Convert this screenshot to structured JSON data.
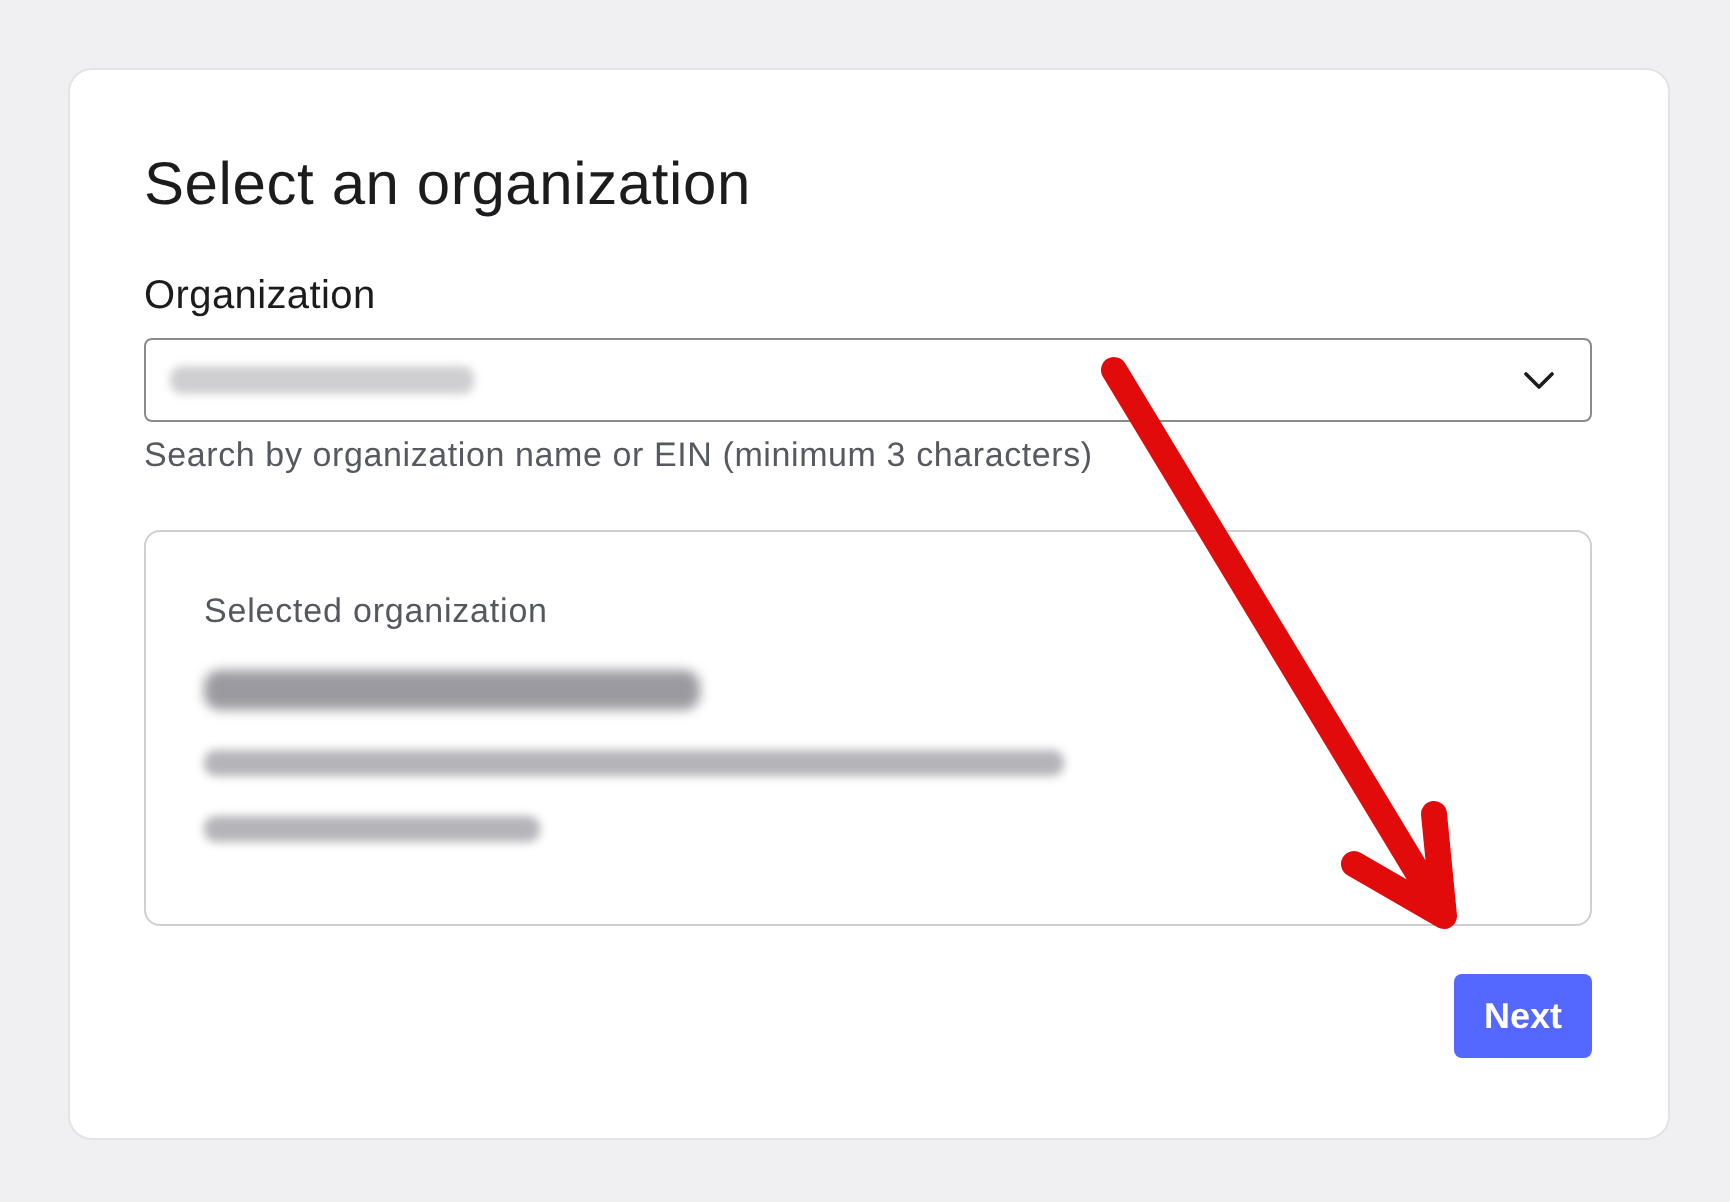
{
  "heading": "Select an organization",
  "organization_field": {
    "label": "Organization",
    "redacted_value": true,
    "helper": "Search by organization name or EIN (minimum 3 characters)"
  },
  "selected_organization": {
    "label": "Selected organization",
    "details": [
      {
        "kind": "title"
      },
      {
        "kind": "line"
      },
      {
        "kind": "line"
      }
    ]
  },
  "buttons": [
    {
      "label": "Next"
    }
  ],
  "annotations": [
    {
      "kind": "arrow"
    }
  ]
}
